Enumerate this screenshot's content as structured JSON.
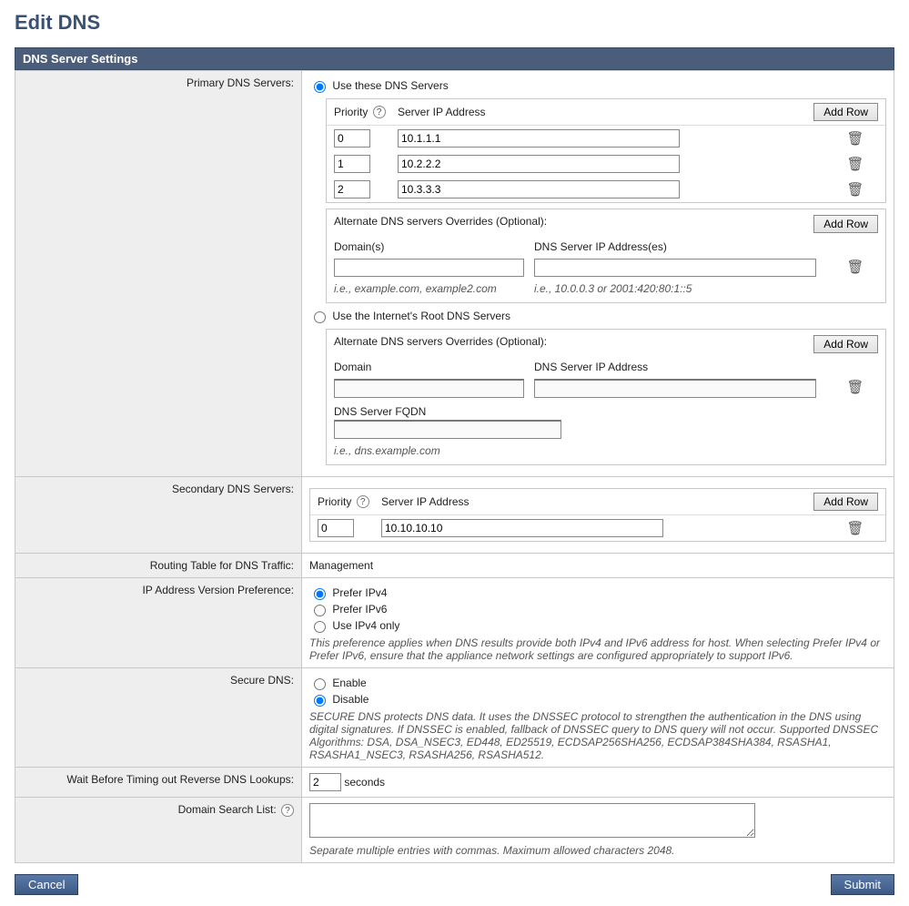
{
  "page_title": "Edit DNS",
  "panel_header": "DNS Server Settings",
  "labels": {
    "primary": "Primary DNS Servers:",
    "secondary": "Secondary DNS Servers:",
    "routing": "Routing Table for DNS Traffic:",
    "ipver": "IP Address Version Preference:",
    "secdns": "Secure DNS:",
    "timeout": "Wait Before Timing out Reverse DNS Lookups:",
    "search": "Domain Search List:"
  },
  "primary": {
    "radio1": "Use these DNS Servers",
    "radio2": "Use the Internet's Root DNS Servers",
    "th_priority": "Priority",
    "th_server": "Server IP Address",
    "add_row": "Add Row",
    "rows": [
      {
        "priority": "0",
        "server": "10.1.1.1"
      },
      {
        "priority": "1",
        "server": "10.2.2.2"
      },
      {
        "priority": "2",
        "server": "10.3.3.3"
      }
    ],
    "alt1": {
      "title": "Alternate DNS servers Overrides (Optional):",
      "add_row": "Add Row",
      "col_domain": "Domain(s)",
      "col_ip": "DNS Server IP Address(es)",
      "domain_val": "",
      "ip_val": "",
      "hint_domain": "i.e., example.com, example2.com",
      "hint_ip": "i.e., 10.0.0.3 or 2001:420:80:1::5"
    },
    "alt2": {
      "title": "Alternate DNS servers Overrides (Optional):",
      "add_row": "Add Row",
      "col_domain": "Domain",
      "col_ip": "DNS Server IP Address",
      "col_fqdn": "DNS Server FQDN",
      "domain_val": "",
      "ip_val": "",
      "fqdn_val": "",
      "hint_fqdn": "i.e., dns.example.com"
    }
  },
  "secondary": {
    "th_priority": "Priority",
    "th_server": "Server IP Address",
    "add_row": "Add Row",
    "rows": [
      {
        "priority": "0",
        "server": "10.10.10.10"
      }
    ]
  },
  "routing_value": "Management",
  "ipver": {
    "opt1": "Prefer IPv4",
    "opt2": "Prefer IPv6",
    "opt3": "Use IPv4 only",
    "note": "This preference applies when DNS results provide both IPv4 and IPv6 address for host. When selecting Prefer IPv4 or Prefer IPv6, ensure that the appliance network settings are configured appropriately to support IPv6."
  },
  "secdns": {
    "enable": "Enable",
    "disable": "Disable",
    "note": "SECURE DNS protects DNS data. It uses the DNSSEC protocol to strengthen the authentication in the DNS using digital signatures. If DNSSEC is enabled, fallback of DNSSEC query to DNS query will not occur. Supported DNSSEC Algorithms: DSA, DSA_NSEC3, ED448, ED25519, ECDSAP256SHA256, ECDSAP384SHA384, RSASHA1, RSASHA1_NSEC3, RSASHA256, RSASHA512."
  },
  "timeout": {
    "value": "2",
    "unit": "seconds"
  },
  "search_note": "Separate multiple entries with commas. Maximum allowed characters 2048.",
  "search_value": "",
  "buttons": {
    "cancel": "Cancel",
    "submit": "Submit"
  }
}
